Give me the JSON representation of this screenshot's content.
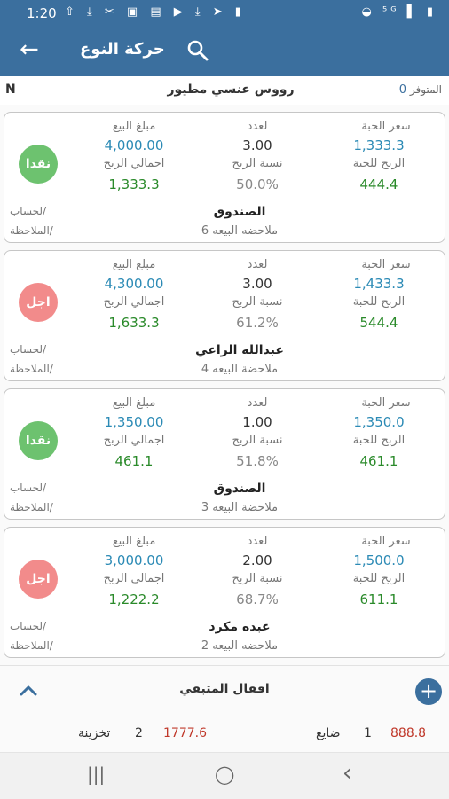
{
  "status": {
    "time": "1:20",
    "left_icons": "⇧ ⤓ ✂ ▣ ▤ ▶ ⤓ ➤ ▮",
    "right_icons": "◒ ⁵ᴳ ▌ ▮"
  },
  "appbar": {
    "title": "حركة النوع",
    "back_icon": "←"
  },
  "subheader": {
    "left_letter": "N",
    "item_name": "رووس عنسي مطيور",
    "available_label": "المتوفر",
    "available_value": "0"
  },
  "labels": {
    "unit_price": "سعر الحبة",
    "count": "لعدد",
    "sale_amount": "مبلغ البيع",
    "profit_per_unit": "الربح للحبة",
    "profit_ratio": "نسبة الربح",
    "total_profit": "اجمالي الربح",
    "account": "/لحساب",
    "remark": "/الملاحظة"
  },
  "cards": [
    {
      "unit_price": "1,333.3",
      "count": "3.00",
      "sale_amount": "4,000.00",
      "profit_per_unit": "444.4",
      "profit_ratio": "50.0%",
      "total_profit": "1,333.3",
      "party": "الصندوق",
      "note": "ملاحضه البيعه 6",
      "payment": "نقدا",
      "payment_color": "#6dc26f"
    },
    {
      "unit_price": "1,433.3",
      "count": "3.00",
      "sale_amount": "4,300.00",
      "profit_per_unit": "544.4",
      "profit_ratio": "61.2%",
      "total_profit": "1,633.3",
      "party": "عبدالله الراعي",
      "note": "ملاحضة البيعه 4",
      "payment": "اجل",
      "payment_color": "#f28b8b"
    },
    {
      "unit_price": "1,350.0",
      "count": "1.00",
      "sale_amount": "1,350.00",
      "profit_per_unit": "461.1",
      "profit_ratio": "51.8%",
      "total_profit": "461.1",
      "party": "الصندوق",
      "note": "ملاحضة البيعه 3",
      "payment": "نقدا",
      "payment_color": "#6dc26f"
    },
    {
      "unit_price": "1,500.0",
      "count": "2.00",
      "sale_amount": "3,000.00",
      "profit_per_unit": "611.1",
      "profit_ratio": "68.7%",
      "total_profit": "1,222.2",
      "party": "عبده مكرد",
      "note": "ملاحضه البيعه 2",
      "payment": "اجل",
      "payment_color": "#f28b8b"
    }
  ],
  "bottom": {
    "close_label": "اقفال المتبقي",
    "lost_value": "888.8",
    "lost_count": "1",
    "lost_label": "ضايع",
    "split_value": "1777.6",
    "split_count": "2",
    "split_label": "تخزينة"
  },
  "navbar": {
    "recent": "|||",
    "home": "◯",
    "back": "‹"
  }
}
